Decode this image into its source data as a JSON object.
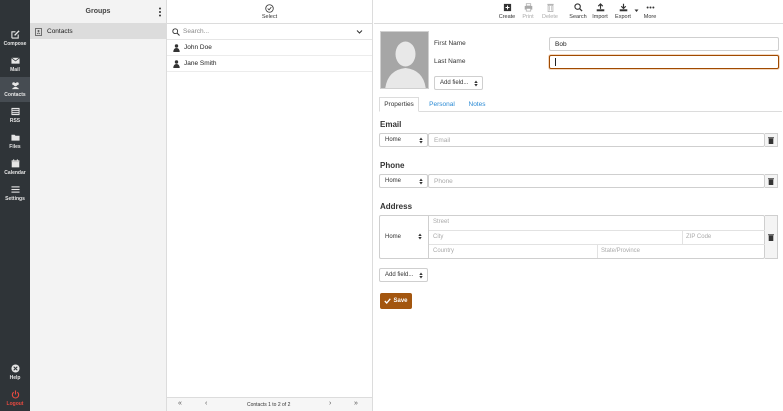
{
  "nav": {
    "items": [
      {
        "label": "Compose",
        "icon": "compose-icon"
      },
      {
        "label": "Mail",
        "icon": "mail-icon"
      },
      {
        "label": "Contacts",
        "icon": "contacts-icon"
      },
      {
        "label": "RSS",
        "icon": "rss-icon"
      },
      {
        "label": "Files",
        "icon": "folder-icon"
      },
      {
        "label": "Calendar",
        "icon": "calendar-icon"
      },
      {
        "label": "Settings",
        "icon": "settings-icon"
      }
    ],
    "help_label": "Help",
    "logout_label": "Logout",
    "active": "Contacts"
  },
  "groups": {
    "title": "Groups",
    "items": [
      {
        "label": "Contacts"
      }
    ]
  },
  "list": {
    "select_label": "Select",
    "search_placeholder": "Search...",
    "contacts": [
      {
        "name": "John Doe"
      },
      {
        "name": "Jane Smith"
      }
    ],
    "pager_text": "Contacts 1 to 2 of 2",
    "pager_first": "«",
    "pager_prev": "‹",
    "pager_next": "›",
    "pager_last": "»"
  },
  "toolbar": {
    "create": "Create",
    "print": "Print",
    "delete": "Delete",
    "search": "Search",
    "import": "Import",
    "export": "Export",
    "more": "More"
  },
  "form": {
    "first_name_label": "First Name",
    "first_name_value": "Bob",
    "last_name_label": "Last Name",
    "last_name_value": "",
    "add_field_label": "Add field...",
    "tabs": [
      "Properties",
      "Personal",
      "Notes"
    ],
    "active_tab": "Properties",
    "email": {
      "heading": "Email",
      "type": "Home",
      "placeholder": "Email"
    },
    "phone": {
      "heading": "Phone",
      "type": "Home",
      "placeholder": "Phone"
    },
    "address": {
      "heading": "Address",
      "type": "Home",
      "street_placeholder": "Street",
      "city_placeholder": "City",
      "zip_placeholder": "ZIP Code",
      "country_placeholder": "Country",
      "state_placeholder": "State/Province"
    },
    "add_field_bottom_label": "Add field...",
    "save_label": "Save"
  },
  "colors": {
    "nav_bg": "#2f3438",
    "accent": "#a3560f",
    "link": "#2a8ad4",
    "logout": "#e84a40"
  }
}
